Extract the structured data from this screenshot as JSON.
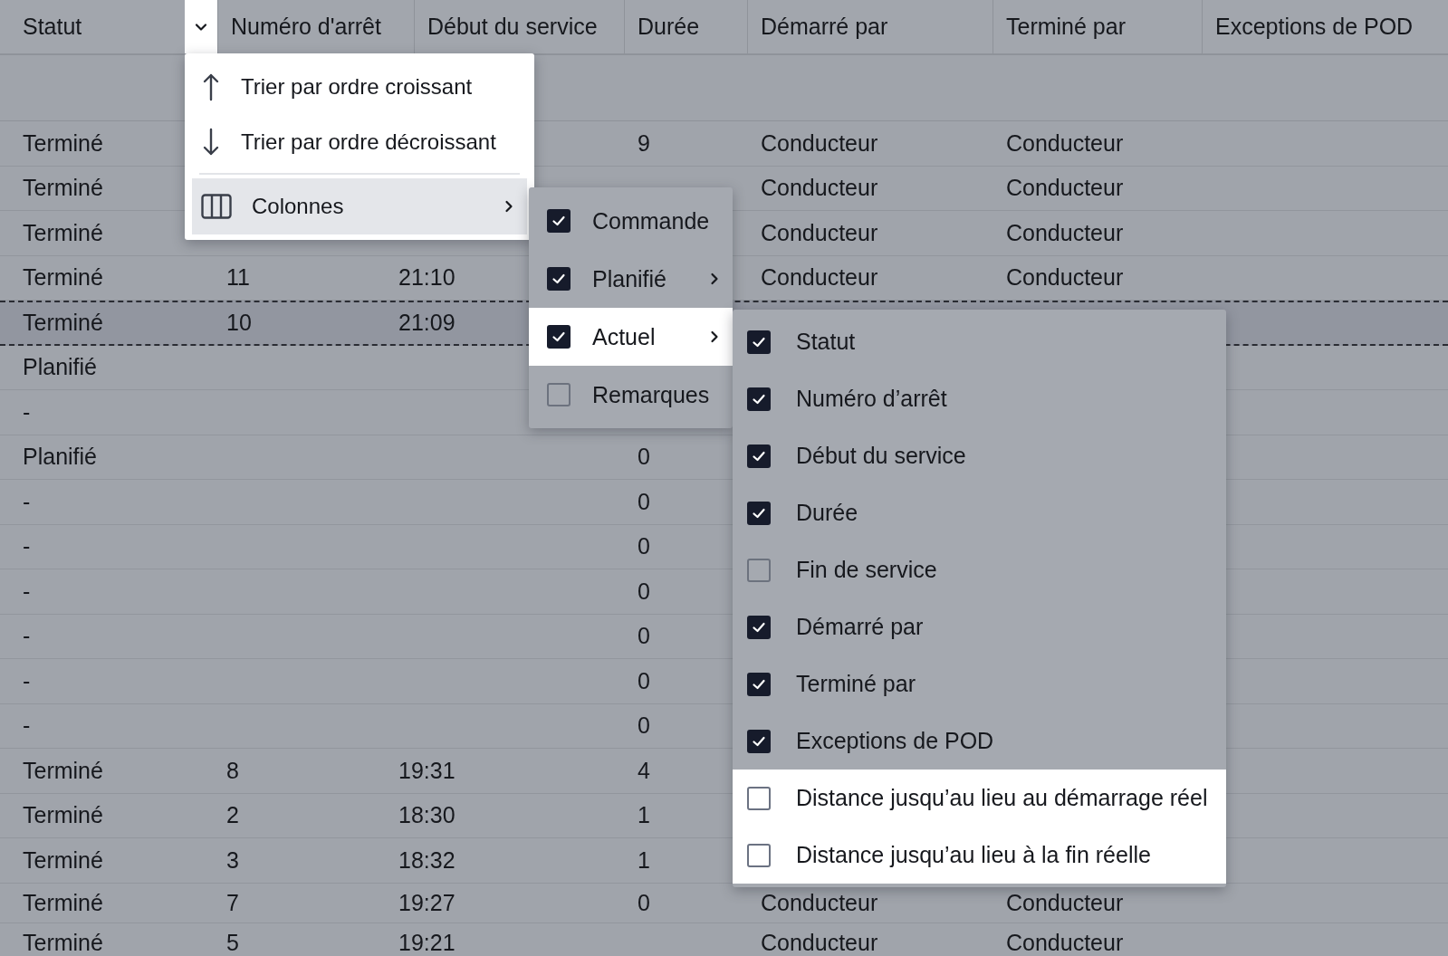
{
  "table": {
    "columns": [
      "Statut",
      "Numéro d'arrêt",
      "Début du service",
      "Durée",
      "Démarré par",
      "Terminé par",
      "Exceptions de POD"
    ],
    "sort_trigger": {
      "spotlight": true
    },
    "rows": [
      {
        "selected": false,
        "statut": "Terminé",
        "duree": "9",
        "demarre_par": "Conducteur",
        "termine_par": "Conducteur"
      },
      {
        "selected": false,
        "statut": "Terminé",
        "demarre_par": "Conducteur",
        "termine_par": "Conducteur"
      },
      {
        "selected": false,
        "statut": "Terminé",
        "demarre_par": "Conducteur",
        "termine_par": "Conducteur"
      },
      {
        "selected": false,
        "statut": "Terminé",
        "numero": "11",
        "debut": "21:10",
        "demarre_par": "Conducteur",
        "termine_par": "Conducteur"
      },
      {
        "selected": true,
        "statut": "Terminé",
        "numero": "10",
        "debut": "21:09"
      },
      {
        "selected": false,
        "statut": "Planifié"
      },
      {
        "selected": false,
        "statut": "-"
      },
      {
        "selected": false,
        "statut": "Planifié",
        "duree": "0"
      },
      {
        "selected": false,
        "statut": "-",
        "duree": "0"
      },
      {
        "selected": false,
        "statut": "-",
        "duree": "0"
      },
      {
        "selected": false,
        "statut": "-",
        "duree": "0"
      },
      {
        "selected": false,
        "statut": "-",
        "duree": "0"
      },
      {
        "selected": false,
        "statut": "-",
        "duree": "0"
      },
      {
        "selected": false,
        "statut": "-",
        "duree": "0"
      },
      {
        "selected": false,
        "statut": "Terminé",
        "numero": "8",
        "debut": "19:31",
        "duree": "4"
      },
      {
        "selected": false,
        "statut": "Terminé",
        "numero": "2",
        "debut": "18:30",
        "duree": "1"
      },
      {
        "selected": false,
        "statut": "Terminé",
        "numero": "3",
        "debut": "18:32",
        "duree": "1"
      },
      {
        "selected": false,
        "statut": "Terminé",
        "numero": "7",
        "debut": "19:27",
        "duree": "0",
        "demarre_par": "Conducteur",
        "termine_par": "Conducteur"
      },
      {
        "selected": false,
        "statut": "Terminé",
        "numero": "5",
        "debut": "19:21",
        "demarre_par": "Conducteur",
        "termine_par": "Conducteur"
      }
    ]
  },
  "column_menu": {
    "spotlight": true,
    "items": [
      {
        "kind": "sort-asc",
        "label": "Trier par ordre croissant",
        "selected": false
      },
      {
        "kind": "sort-desc",
        "label": "Trier par ordre décroissant",
        "selected": false
      },
      {
        "kind": "columns",
        "label": "Colonnes",
        "selected": true
      }
    ]
  },
  "columns_submenu": {
    "items": [
      {
        "label": "Commande",
        "checked": true,
        "has_submenu": false,
        "spotlight": false
      },
      {
        "label": "Planifié",
        "checked": true,
        "has_submenu": true,
        "spotlight": false
      },
      {
        "label": "Actuel",
        "checked": true,
        "has_submenu": true,
        "spotlight": true
      },
      {
        "label": "Remarques",
        "checked": false,
        "has_submenu": false,
        "spotlight": false
      }
    ]
  },
  "actual_submenu": {
    "items": [
      {
        "label": "Statut",
        "checked": true,
        "spotlight": false
      },
      {
        "label": "Numéro d’arrêt",
        "checked": true,
        "spotlight": false
      },
      {
        "label": "Début du service",
        "checked": true,
        "spotlight": false
      },
      {
        "label": "Durée",
        "checked": true,
        "spotlight": false
      },
      {
        "label": "Fin de service",
        "checked": false,
        "spotlight": false
      },
      {
        "label": "Démarré par",
        "checked": true,
        "spotlight": false
      },
      {
        "label": "Terminé par",
        "checked": true,
        "spotlight": false
      },
      {
        "label": "Exceptions de POD",
        "checked": true,
        "spotlight": false
      },
      {
        "label": "Distance jusqu’au lieu au démarrage réel",
        "checked": false,
        "spotlight": true
      },
      {
        "label": "Distance jusqu’au lieu à la fin réelle",
        "checked": false,
        "spotlight": true
      }
    ]
  }
}
